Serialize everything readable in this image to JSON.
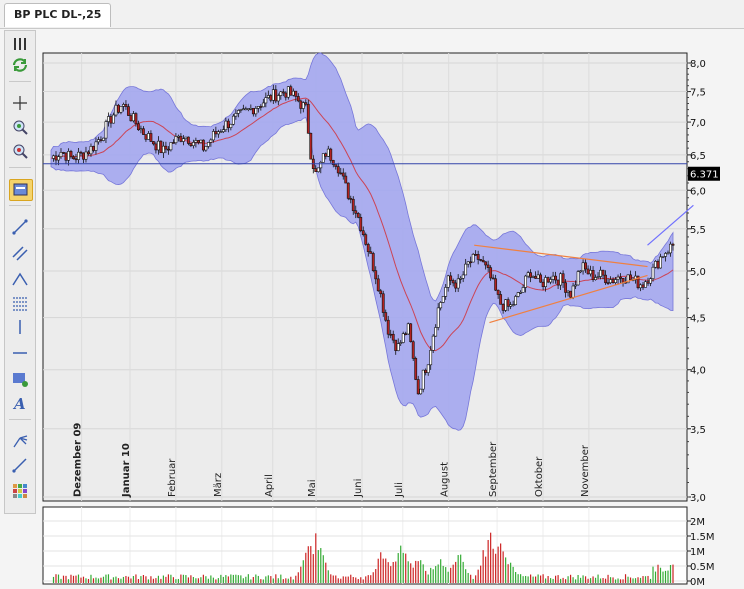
{
  "tab": {
    "label": "BP PLC DL-,25"
  },
  "toolbar": {
    "tools": [
      {
        "name": "grip-icon"
      },
      {
        "name": "refresh-icon"
      },
      {
        "name": "crosshair-icon"
      },
      {
        "name": "zoom-in-icon"
      },
      {
        "name": "zoom-out-icon"
      },
      {
        "name": "indicator-icon"
      },
      {
        "name": "line-tool-icon"
      },
      {
        "name": "channel-tool-icon"
      },
      {
        "name": "polyline-tool-icon"
      },
      {
        "name": "fibonacci-icon"
      },
      {
        "name": "vertical-line-icon"
      },
      {
        "name": "horizontal-line-icon"
      },
      {
        "name": "rectangle-tool-icon"
      },
      {
        "name": "text-tool-icon"
      },
      {
        "name": "pitchfork-icon"
      },
      {
        "name": "ray-tool-icon"
      },
      {
        "name": "color-grid-icon"
      }
    ]
  },
  "chart_data": {
    "type": "candlestick",
    "title": "BP PLC DL-,25",
    "price_axis": {
      "ticks": [
        "8,0",
        "7,5",
        "7,0",
        "6,5",
        "6,0",
        "5,5",
        "5,0",
        "4,5",
        "4,0",
        "3,5",
        "3,0"
      ],
      "tick_values": [
        8.0,
        7.5,
        7.0,
        6.5,
        6.0,
        5.5,
        5.0,
        4.5,
        4.0,
        3.5,
        3.0
      ],
      "scale": "log"
    },
    "current_price": {
      "label": "6.371",
      "value": 6.371
    },
    "volume_axis": {
      "ticks": [
        "2M",
        "1.5M",
        "1M",
        "0.5M",
        "0M"
      ],
      "tick_values": [
        2.0,
        1.5,
        1.0,
        0.5,
        0.0
      ]
    },
    "month_labels": [
      {
        "label": "Dezember 09",
        "bold": true,
        "t": 0.06
      },
      {
        "label": "Januar 10",
        "bold": true,
        "t": 0.155
      },
      {
        "label": "Februar",
        "bold": false,
        "t": 0.245
      },
      {
        "label": "März",
        "bold": false,
        "t": 0.335
      },
      {
        "label": "April",
        "bold": false,
        "t": 0.435
      },
      {
        "label": "Mai",
        "bold": false,
        "t": 0.52
      },
      {
        "label": "Juni",
        "bold": false,
        "t": 0.61
      },
      {
        "label": "Juli",
        "bold": false,
        "t": 0.69
      },
      {
        "label": "August",
        "bold": false,
        "t": 0.78
      },
      {
        "label": "September",
        "bold": false,
        "t": 0.875
      },
      {
        "label": "Oktober",
        "bold": false,
        "t": 0.965
      },
      {
        "label": "November",
        "bold": false,
        "t": 1.055
      }
    ],
    "price_path": [
      [
        0.0,
        6.45
      ],
      [
        0.02,
        6.55
      ],
      [
        0.04,
        6.45
      ],
      [
        0.06,
        6.5
      ],
      [
        0.08,
        6.6
      ],
      [
        0.1,
        6.8
      ],
      [
        0.12,
        7.1
      ],
      [
        0.14,
        7.3
      ],
      [
        0.16,
        7.05
      ],
      [
        0.18,
        6.85
      ],
      [
        0.2,
        6.7
      ],
      [
        0.22,
        6.55
      ],
      [
        0.24,
        6.7
      ],
      [
        0.26,
        6.8
      ],
      [
        0.28,
        6.7
      ],
      [
        0.3,
        6.6
      ],
      [
        0.32,
        6.8
      ],
      [
        0.34,
        6.95
      ],
      [
        0.36,
        7.05
      ],
      [
        0.38,
        7.15
      ],
      [
        0.4,
        7.25
      ],
      [
        0.42,
        7.35
      ],
      [
        0.44,
        7.45
      ],
      [
        0.46,
        7.5
      ],
      [
        0.48,
        7.4
      ],
      [
        0.5,
        7.2
      ],
      [
        0.51,
        6.5
      ],
      [
        0.52,
        6.2
      ],
      [
        0.54,
        6.55
      ],
      [
        0.56,
        6.4
      ],
      [
        0.58,
        6.0
      ],
      [
        0.6,
        5.7
      ],
      [
        0.62,
        5.3
      ],
      [
        0.64,
        4.9
      ],
      [
        0.66,
        4.4
      ],
      [
        0.68,
        4.2
      ],
      [
        0.7,
        4.4
      ],
      [
        0.72,
        3.8
      ],
      [
        0.74,
        4.1
      ],
      [
        0.76,
        4.6
      ],
      [
        0.78,
        4.9
      ],
      [
        0.8,
        4.85
      ],
      [
        0.82,
        5.1
      ],
      [
        0.84,
        5.15
      ],
      [
        0.86,
        4.95
      ],
      [
        0.88,
        4.65
      ],
      [
        0.9,
        4.6
      ],
      [
        0.92,
        4.75
      ],
      [
        0.94,
        5.0
      ],
      [
        0.96,
        4.85
      ],
      [
        0.98,
        4.95
      ],
      [
        1.0,
        4.9
      ],
      [
        1.02,
        4.75
      ],
      [
        1.04,
        5.05
      ],
      [
        1.06,
        4.95
      ],
      [
        1.08,
        4.95
      ],
      [
        1.1,
        4.9
      ],
      [
        1.12,
        4.95
      ],
      [
        1.14,
        4.9
      ],
      [
        1.16,
        4.85
      ],
      [
        1.18,
        5.0
      ],
      [
        1.2,
        5.2
      ],
      [
        1.22,
        5.3
      ]
    ],
    "volume_highlights": [
      [
        0.505,
        1.4
      ],
      [
        0.52,
        1.8
      ],
      [
        0.65,
        1.1
      ],
      [
        0.68,
        0.95
      ],
      [
        0.69,
        1.5
      ],
      [
        0.72,
        1.0
      ],
      [
        0.76,
        0.9
      ],
      [
        0.8,
        1.1
      ],
      [
        0.86,
        1.8
      ],
      [
        0.88,
        1.4
      ],
      [
        0.9,
        0.7
      ]
    ],
    "bollinger_upper_offset": 0.35,
    "trendlines": [
      {
        "name": "upper-triangle-line",
        "from": [
          0.83,
          5.3
        ],
        "to": [
          1.17,
          5.05
        ],
        "color": "#f08040"
      },
      {
        "name": "lower-triangle-line",
        "from": [
          0.86,
          4.45
        ],
        "to": [
          1.17,
          4.95
        ],
        "color": "#f08040"
      },
      {
        "name": "projection-line",
        "from": [
          1.17,
          5.3
        ],
        "to": [
          1.26,
          5.8
        ],
        "color": "#7070ff"
      },
      {
        "name": "current-price-line",
        "value": 6.371,
        "color": "#3344aa"
      }
    ],
    "colors": {
      "band": "#a4a8f0",
      "band_edge": "#6a6ad8",
      "ma": "#cc4455",
      "up": "#ffffff",
      "down": "#b22222",
      "vol_up": "#33aa33",
      "vol_down": "#cc2222",
      "price_tag": "#000000"
    }
  }
}
